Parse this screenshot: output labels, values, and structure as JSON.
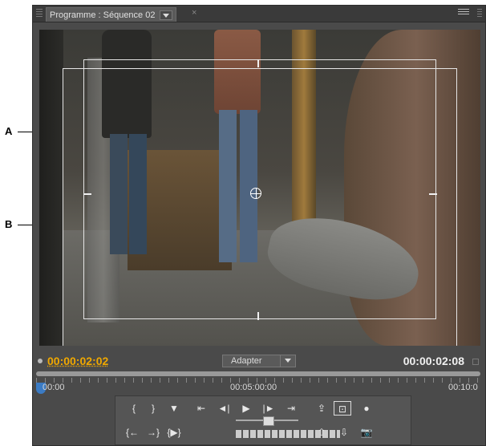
{
  "callouts": {
    "a": "A",
    "b": "B"
  },
  "panel": {
    "tab_title": "Programme : Séquence 02",
    "close_symbol": "×"
  },
  "timecode": {
    "current": "00:00:02:02",
    "duration": "00:00:02:08"
  },
  "zoom": {
    "selected": "Adapter"
  },
  "ruler": {
    "labels": [
      "00:00",
      "00:05:00:00",
      "00:10:0"
    ]
  },
  "controls": {
    "row1": [
      "{",
      "}",
      "▼",
      "⇤",
      "◄|",
      "▶",
      "|►",
      "⇥",
      "⇪",
      "⊡",
      "●"
    ],
    "row2": [
      "{←",
      "→}",
      "{▶}",
      "⇧",
      "⇩",
      "📷"
    ]
  },
  "icons": {
    "tab_dropdown": "chevron-down-icon",
    "panel_menu": "menu-icon",
    "crosshair": "crosshair-icon",
    "playhead": "playhead-icon"
  },
  "colors": {
    "panel_bg": "#4a4a4a",
    "current_timecode": "#f0a800",
    "duration_timecode": "#f0f0f0",
    "playhead": "#3b7bc4"
  }
}
